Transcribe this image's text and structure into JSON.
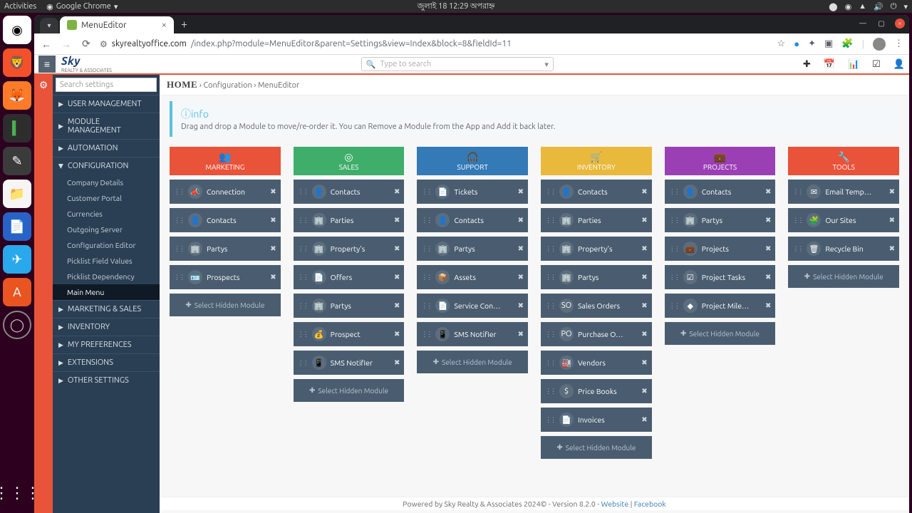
{
  "sys": {
    "activities": "Activities",
    "app": "Google Chrome",
    "date": "জুলাই 18  12:29 অপরাহ্ন"
  },
  "tab": {
    "title": "MenuEditor"
  },
  "url": {
    "host": "skyrealtyoffice.com",
    "path": "/index.php?module=MenuEditor&parent=Settings&view=Index&block=8&fieldId=11"
  },
  "search_placeholder": "Type to search",
  "sidebar_search": "Search settings",
  "sidebar": {
    "groups": [
      {
        "label": "USER MANAGEMENT",
        "expanded": false
      },
      {
        "label": "MODULE MANAGEMENT",
        "expanded": false
      },
      {
        "label": "AUTOMATION",
        "expanded": false
      },
      {
        "label": "CONFIGURATION",
        "expanded": true,
        "items": [
          "Company Details",
          "Customer Portal",
          "Currencies",
          "Outgoing Server",
          "Configuration Editor",
          "Picklist Field Values",
          "Picklist Dependency",
          "Main Menu"
        ],
        "active": "Main Menu"
      },
      {
        "label": "MARKETING & SALES",
        "expanded": false
      },
      {
        "label": "INVENTORY",
        "expanded": false
      },
      {
        "label": "MY PREFERENCES",
        "expanded": false
      },
      {
        "label": "EXTENSIONS",
        "expanded": false
      },
      {
        "label": "OTHER SETTINGS",
        "expanded": false
      }
    ]
  },
  "breadcrumb": {
    "home": "HOME",
    "a": "Configuration",
    "b": "MenuEditor"
  },
  "info": {
    "title": "info",
    "body": "Drag and drop a Module to move/re-order it. You can Remove a Module from the App and Add it back later."
  },
  "add_module_label": "Select Hidden Module",
  "columns": [
    {
      "title": "MARKETING",
      "cls": "c-marketing",
      "icon": "👥",
      "mods": [
        {
          "name": "Connection",
          "icon": "📣"
        },
        {
          "name": "Contacts",
          "icon": "👤"
        },
        {
          "name": "Partys",
          "icon": "🏢"
        },
        {
          "name": "Prospects",
          "icon": "🪪"
        }
      ]
    },
    {
      "title": "SALES",
      "cls": "c-sales",
      "icon": "◎",
      "mods": [
        {
          "name": "Contacts",
          "icon": "👤"
        },
        {
          "name": "Parties",
          "icon": "🏢"
        },
        {
          "name": "Property's",
          "icon": "🏢"
        },
        {
          "name": "Offers",
          "icon": "📄"
        },
        {
          "name": "Partys",
          "icon": "🏢"
        },
        {
          "name": "Prospect",
          "icon": "💰"
        },
        {
          "name": "SMS Notifier",
          "icon": "📱"
        }
      ]
    },
    {
      "title": "SUPPORT",
      "cls": "c-support",
      "icon": "🎧",
      "mods": [
        {
          "name": "Tickets",
          "icon": "📄"
        },
        {
          "name": "Contacts",
          "icon": "👤"
        },
        {
          "name": "Partys",
          "icon": "🏢"
        },
        {
          "name": "Assets",
          "icon": "📦"
        },
        {
          "name": "Service Con…",
          "icon": "📄"
        },
        {
          "name": "SMS Notifier",
          "icon": "📱"
        }
      ]
    },
    {
      "title": "INVENTORY",
      "cls": "c-inventory",
      "icon": "🛒",
      "mods": [
        {
          "name": "Contacts",
          "icon": "👤"
        },
        {
          "name": "Parties",
          "icon": "🏢"
        },
        {
          "name": "Property's",
          "icon": "🏢"
        },
        {
          "name": "Partys",
          "icon": "🏢"
        },
        {
          "name": "Sales Orders",
          "icon": "SO"
        },
        {
          "name": "Purchase O…",
          "icon": "PO"
        },
        {
          "name": "Vendors",
          "icon": "🏭"
        },
        {
          "name": "Price Books",
          "icon": "$"
        },
        {
          "name": "Invoices",
          "icon": "📄"
        }
      ]
    },
    {
      "title": "PROJECTS",
      "cls": "c-projects",
      "icon": "💼",
      "mods": [
        {
          "name": "Contacts",
          "icon": "👤"
        },
        {
          "name": "Partys",
          "icon": "🏢"
        },
        {
          "name": "Projects",
          "icon": "💼"
        },
        {
          "name": "Project Tasks",
          "icon": "☑"
        },
        {
          "name": "Project Mile…",
          "icon": "◆"
        }
      ]
    },
    {
      "title": "TOOLS",
      "cls": "c-tools",
      "icon": "🔧",
      "mods": [
        {
          "name": "Email Temp…",
          "icon": "✉"
        },
        {
          "name": "Our Sites",
          "icon": "🧩"
        },
        {
          "name": "Recycle Bin",
          "icon": "🗑"
        }
      ]
    }
  ],
  "footer": {
    "text": "Powered by Sky Realty & Associates 2024© - Version 8.2.0 - ",
    "website": "Website",
    "sep": "  |  ",
    "fb": "Facebook"
  }
}
